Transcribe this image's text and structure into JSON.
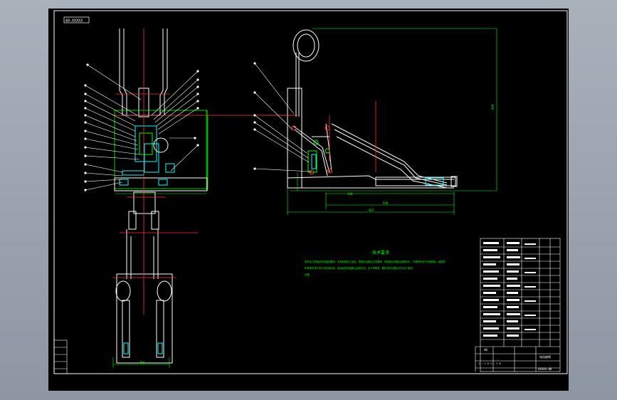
{
  "drawing": {
    "top_left_label": "A0-XXXXX",
    "tech_requirements_title": "技术要求",
    "tech_requirements_lines": [
      "零件加工精度应符合图纸要求，采用机械加工保证，表面光洁度应达到要求，焊接部位焊缝应饱满均匀，不得有夹渣气孔等缺陷，装配前",
      "所有零件须清洗干净去除毛刺，各运动部件装配后运转灵活，无卡滞现象，整机调试合格后方可出厂使用，",
      "合格。"
    ],
    "title_block": {
      "product_name": "电动座椅",
      "drawing_no": "XXXXX-00",
      "scale_row": "1 : 1 0  1 : 1 0",
      "grid_label": "A0"
    },
    "dimension_labels": {
      "bottom_width": "450",
      "total_length": "987",
      "inner_length": "590",
      "height": "900",
      "front_height": "500"
    }
  },
  "colors": {
    "canvas": "#000000",
    "frame": "#ffffff",
    "geometry": "#ffffff",
    "dimension": "#00ff00",
    "center_line": "#ff3030",
    "component": "#00ffff",
    "hatch": "#ff3030"
  }
}
